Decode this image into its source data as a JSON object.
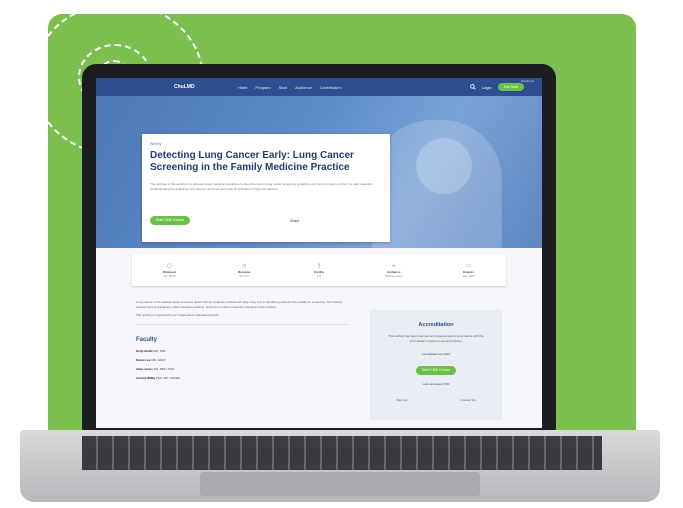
{
  "site": {
    "logo": "ChuLMD",
    "nav_links": [
      "Hotel",
      "Program",
      "Start",
      "Audience",
      "Contributors"
    ],
    "nav_search_icon": "search-icon",
    "nav_login": "Login",
    "nav_join": "Join Now",
    "top_strip": "Facebook"
  },
  "article": {
    "kicker": "Weekly",
    "title": "Detecting Lung Cancer Early: Lung Cancer Screening in the Family Medicine Practice",
    "description": "The purpose of this activity is to educate family medicine practitioners about the current lung cancer screening guidelines and how to implement them for early detection. Understanding the guidelines can improve outcomes and early identification of high-risk patients.",
    "register_label": "Start CME Course",
    "save_label": "Share"
  },
  "stats": [
    {
      "icon": "calendar-icon",
      "label": "Released",
      "value": "Jan 2023"
    },
    {
      "icon": "clock-icon",
      "label": "Duration",
      "value": "60 min"
    },
    {
      "icon": "certificate-icon",
      "label": "Credits",
      "value": "1.0"
    },
    {
      "icon": "stethoscope-icon",
      "label": "Audience",
      "value": "Primary Care"
    },
    {
      "icon": "expire-icon",
      "label": "Expires",
      "value": "Jan 2025"
    }
  ],
  "body": {
    "intro": "Lung cancer is the leading cause of cancer death. Family medicine practitioners play a key role in identifying patients who qualify for screening. This activity reviews current guidelines, shared decision-making, and how to build a screening workflow in the practice.",
    "note": "This activity is supported by an independent educational grant.",
    "faculty_title": "Faculty",
    "faculty": [
      {
        "name": "Kenji Smith",
        "creds": "MD, PhD"
      },
      {
        "name": "Karen Lee",
        "creds": "MD, FACP"
      },
      {
        "name": "Allen Jones",
        "creds": "DO, MPH, PhD"
      },
      {
        "name": "Andrea Willig",
        "creds": "PhD, RD, CDCES"
      }
    ]
  },
  "accreditation": {
    "title": "Accreditation",
    "text": "This activity has been planned and implemented in accordance with the accreditation requirements and policies.",
    "expiration": "Last Edited Jan 2024",
    "start_label": "Start CME Course",
    "credits": "Last accessed  1700",
    "link_left": "Sign Up",
    "link_right": "Contact Us"
  }
}
